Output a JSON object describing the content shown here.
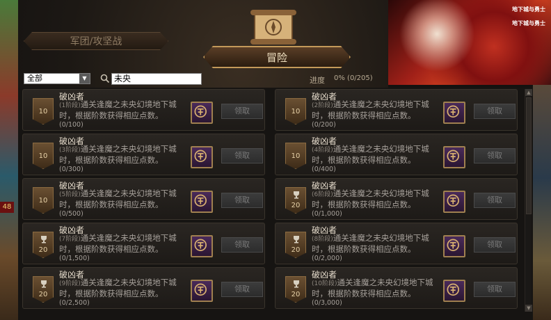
{
  "tabs": {
    "left_label": "军团/攻坚战",
    "main_label": "冒险"
  },
  "toolbar": {
    "filter_value": "全部",
    "search_value": "未央",
    "progress_label": "进度",
    "progress_value": "0%  (0/205)"
  },
  "cards": [
    {
      "title": "破凶者",
      "stage": "(1阶段)",
      "desc": "通关逢魔之未央幻境地下城时，根据阶数获得相应点数。",
      "count": "(0/100)",
      "points": "10",
      "trophy": false,
      "claim": "领取"
    },
    {
      "title": "破凶者",
      "stage": "(2阶段)",
      "desc": "通关逢魔之未央幻境地下城时，根据阶数获得相应点数。",
      "count": "(0/200)",
      "points": "10",
      "trophy": false,
      "claim": "领取"
    },
    {
      "title": "破凶者",
      "stage": "(3阶段)",
      "desc": "通关逢魔之未央幻境地下城时，根据阶数获得相应点数。",
      "count": "(0/300)",
      "points": "10",
      "trophy": false,
      "claim": "领取"
    },
    {
      "title": "破凶者",
      "stage": "(4阶段)",
      "desc": "通关逢魔之未央幻境地下城时，根据阶数获得相应点数。",
      "count": "(0/400)",
      "points": "10",
      "trophy": false,
      "claim": "领取"
    },
    {
      "title": "破凶者",
      "stage": "(5阶段)",
      "desc": "通关逢魔之未央幻境地下城时，根据阶数获得相应点数。",
      "count": "(0/500)",
      "points": "10",
      "trophy": false,
      "claim": "领取"
    },
    {
      "title": "破凶者",
      "stage": "(6阶段)",
      "desc": "通关逢魔之未央幻境地下城时，根据阶数获得相应点数。",
      "count": "(0/1,000)",
      "points": "20",
      "trophy": true,
      "claim": "领取"
    },
    {
      "title": "破凶者",
      "stage": "(7阶段)",
      "desc": "通关逢魔之未央幻境地下城时，根据阶数获得相应点数。",
      "count": "(0/1,500)",
      "points": "20",
      "trophy": true,
      "claim": "领取"
    },
    {
      "title": "破凶者",
      "stage": "(8阶段)",
      "desc": "通关逢魔之未央幻境地下城时，根据阶数获得相应点数。",
      "count": "(0/2,000)",
      "points": "20",
      "trophy": true,
      "claim": "领取"
    },
    {
      "title": "破凶者",
      "stage": "(9阶段)",
      "desc": "通关逢魔之未央幻境地下城时，根据阶数获得相应点数。",
      "count": "(0/2,500)",
      "points": "20",
      "trophy": true,
      "claim": "领取"
    },
    {
      "title": "破凶者",
      "stage": "(10阶段)",
      "desc": "通关逢魔之未央幻境地下城时，根据阶数获得相应点数。",
      "count": "(0/3,000)",
      "points": "20",
      "trophy": true,
      "claim": "领取"
    }
  ],
  "banner": {
    "logo_text": "地下城与勇士"
  },
  "side": {
    "left_tag": "48"
  },
  "colors": {
    "accent_gold": "#c49a5a",
    "panel_dark": "#1c1814",
    "claim_disabled": "#7a7a7a"
  }
}
